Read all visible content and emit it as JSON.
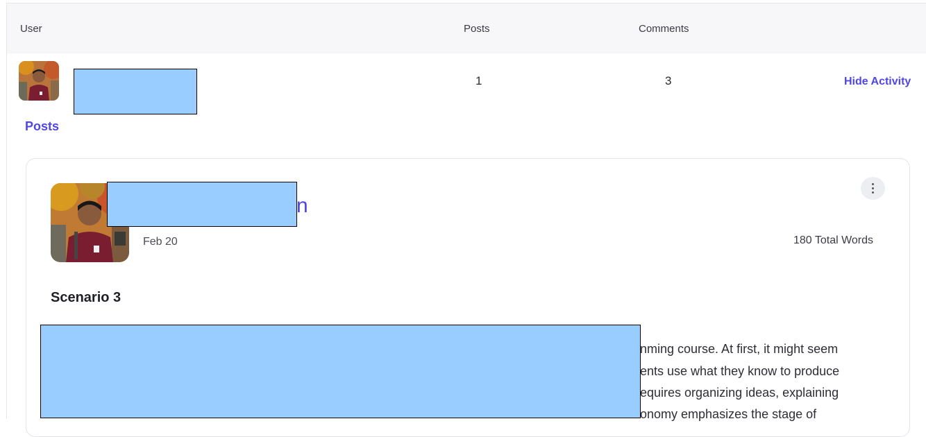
{
  "table": {
    "headers": {
      "user": "User",
      "posts": "Posts",
      "comments": "Comments"
    },
    "row": {
      "posts": "1",
      "comments": "3",
      "action": "Hide Activity"
    }
  },
  "activity": {
    "section_title": "Posts"
  },
  "post": {
    "author_name_visible": "n",
    "date": "Feb 20",
    "word_count": "180 Total Words",
    "title": "Scenario 3",
    "body_lines": [
      "nming course. At first, it might seem",
      "ents use what they know to produce",
      "equires organizing ideas, explaining",
      "onomy emphasizes the stage of"
    ]
  },
  "colors": {
    "accent": "#4f46e5",
    "redaction": "#99ccff",
    "header_bg": "#f7f7f9"
  },
  "icons": {
    "menu": "kebab-icon"
  }
}
